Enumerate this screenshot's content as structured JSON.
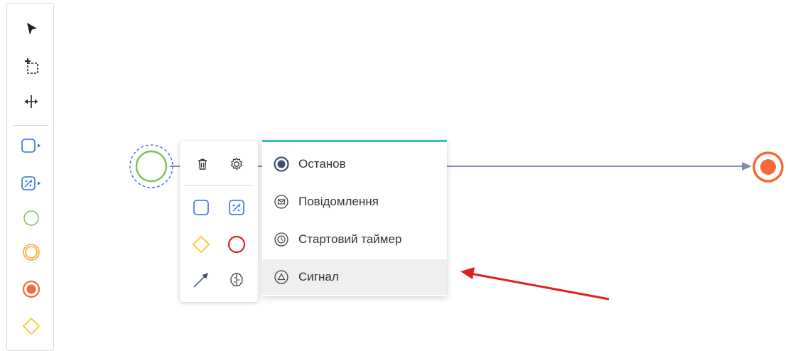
{
  "palette": {
    "tools": [
      {
        "name": "pointer-tool-icon"
      },
      {
        "name": "lasso-tool-icon"
      },
      {
        "name": "space-tool-icon"
      }
    ],
    "shapes": [
      {
        "name": "task-icon",
        "color": "#2f6fde"
      },
      {
        "name": "subprocess-icon",
        "color": "#2f6fde"
      },
      {
        "name": "start-event-icon",
        "color": "#7ac25a"
      },
      {
        "name": "intermediate-event-icon",
        "color": "#f5a623"
      },
      {
        "name": "end-event-icon",
        "color": "#f26b3a"
      },
      {
        "name": "gateway-icon",
        "color": "#f5c518"
      }
    ]
  },
  "context_pad": {
    "actions": [
      "trash-icon",
      "gear-icon"
    ],
    "shapes": [
      "task-icon",
      "subprocess-icon",
      "gateway-icon",
      "end-event-icon",
      "connection-arrow-icon",
      "ai-brain-icon"
    ]
  },
  "replace_menu": {
    "accent_color": "#3dbbd0",
    "items": [
      {
        "label": "Останов",
        "icon": "terminate-icon",
        "hovered": false
      },
      {
        "label": "Повідомлення",
        "icon": "message-icon",
        "hovered": false
      },
      {
        "label": "Стартовий таймер",
        "icon": "timer-icon",
        "hovered": false
      },
      {
        "label": "Сигнал",
        "icon": "signal-icon",
        "hovered": true
      }
    ]
  },
  "diagram": {
    "start_event_color": "#7ac25a",
    "end_event_color": "#f26b3a",
    "flow_color": "#7d8ea8",
    "annotation_arrow_color": "#e02020"
  }
}
